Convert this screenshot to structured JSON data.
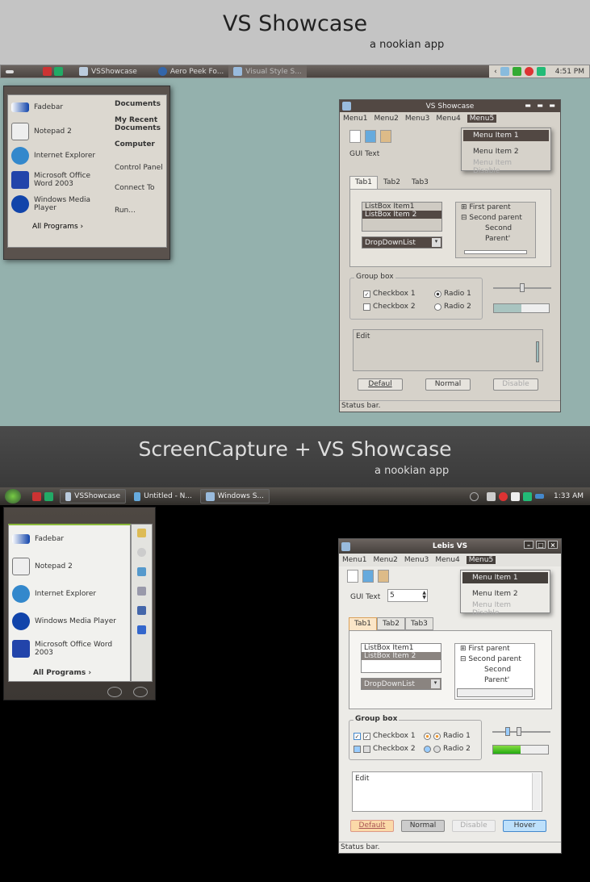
{
  "header1": {
    "title": "VS Showcase",
    "subtitle": "a nookian app"
  },
  "taskbar1": {
    "items": [
      "VSShowcase",
      "Aero Peek Fo...",
      "Visual Style S..."
    ],
    "clock": "4:51 PM"
  },
  "startmenu1": {
    "left": [
      "Fadebar",
      "Notepad 2",
      "Internet Explorer",
      "Microsoft Office Word 2003",
      "Windows Media Player"
    ],
    "all_programs": "All Programs",
    "right": [
      "Documents",
      "My Recent Documents",
      "Computer",
      "Control Panel",
      "Connect To",
      "Run..."
    ]
  },
  "window1": {
    "title": "VS Showcase",
    "menus": [
      "Menu1",
      "Menu2",
      "Menu3",
      "Menu4",
      "Menu5"
    ],
    "dropdown": [
      "Menu Item 1",
      "Menu Item 2",
      "Menu Item Disable"
    ],
    "gui_text": "GUI Text",
    "tabs": [
      "Tab1",
      "Tab2",
      "Tab3"
    ],
    "listbox": [
      "ListBox Item1",
      "ListBox Item 2"
    ],
    "dropdownlist": "DropDownList",
    "tree": [
      "First parent",
      "Second parent",
      "Second Parent'"
    ],
    "groupbox": "Group box",
    "checkboxes": [
      "Checkbox 1",
      "Checkbox 2"
    ],
    "radios": [
      "Radio 1",
      "Radio 2"
    ],
    "edit": "Edit",
    "buttons": [
      "Defaul",
      "Normal",
      "Disable"
    ],
    "status": "Status bar.",
    "slider": 0.5,
    "progress": 0.5
  },
  "header2": {
    "title": "ScreenCapture + VS Showcase",
    "subtitle": "a nookian app"
  },
  "taskbar2": {
    "items": [
      "VSShowcase",
      "Untitled - N...",
      "Windows S..."
    ],
    "clock": "1:33 AM"
  },
  "startmenu2": {
    "left": [
      "Fadebar",
      "Notepad 2",
      "Internet Explorer",
      "Windows Media Player",
      "Microsoft Office Word 2003"
    ],
    "all_programs": "All Programs"
  },
  "window2": {
    "title": "Lebis VS",
    "menus": [
      "Menu1",
      "Menu2",
      "Menu3",
      "Menu4",
      "Menu5"
    ],
    "dropdown": [
      "Menu Item 1",
      "Menu Item 2",
      "Menu Item Disable"
    ],
    "gui_text": "GUI Text",
    "spin_value": "5",
    "tabs": [
      "Tab1",
      "Tab2",
      "Tab3"
    ],
    "listbox": [
      "ListBox Item1",
      "ListBox Item 2"
    ],
    "dropdownlist": "DropDownList",
    "tree": [
      "First parent",
      "Second parent",
      "Second Parent'"
    ],
    "groupbox": "Group box",
    "checkboxes": [
      "Checkbox 1",
      "Checkbox 2"
    ],
    "radios": [
      "Radio 1",
      "Radio 2"
    ],
    "edit": "Edit",
    "buttons": [
      "Default",
      "Normal",
      "Disable",
      "Hover"
    ],
    "status": "Status bar.",
    "progress": 0.5
  }
}
